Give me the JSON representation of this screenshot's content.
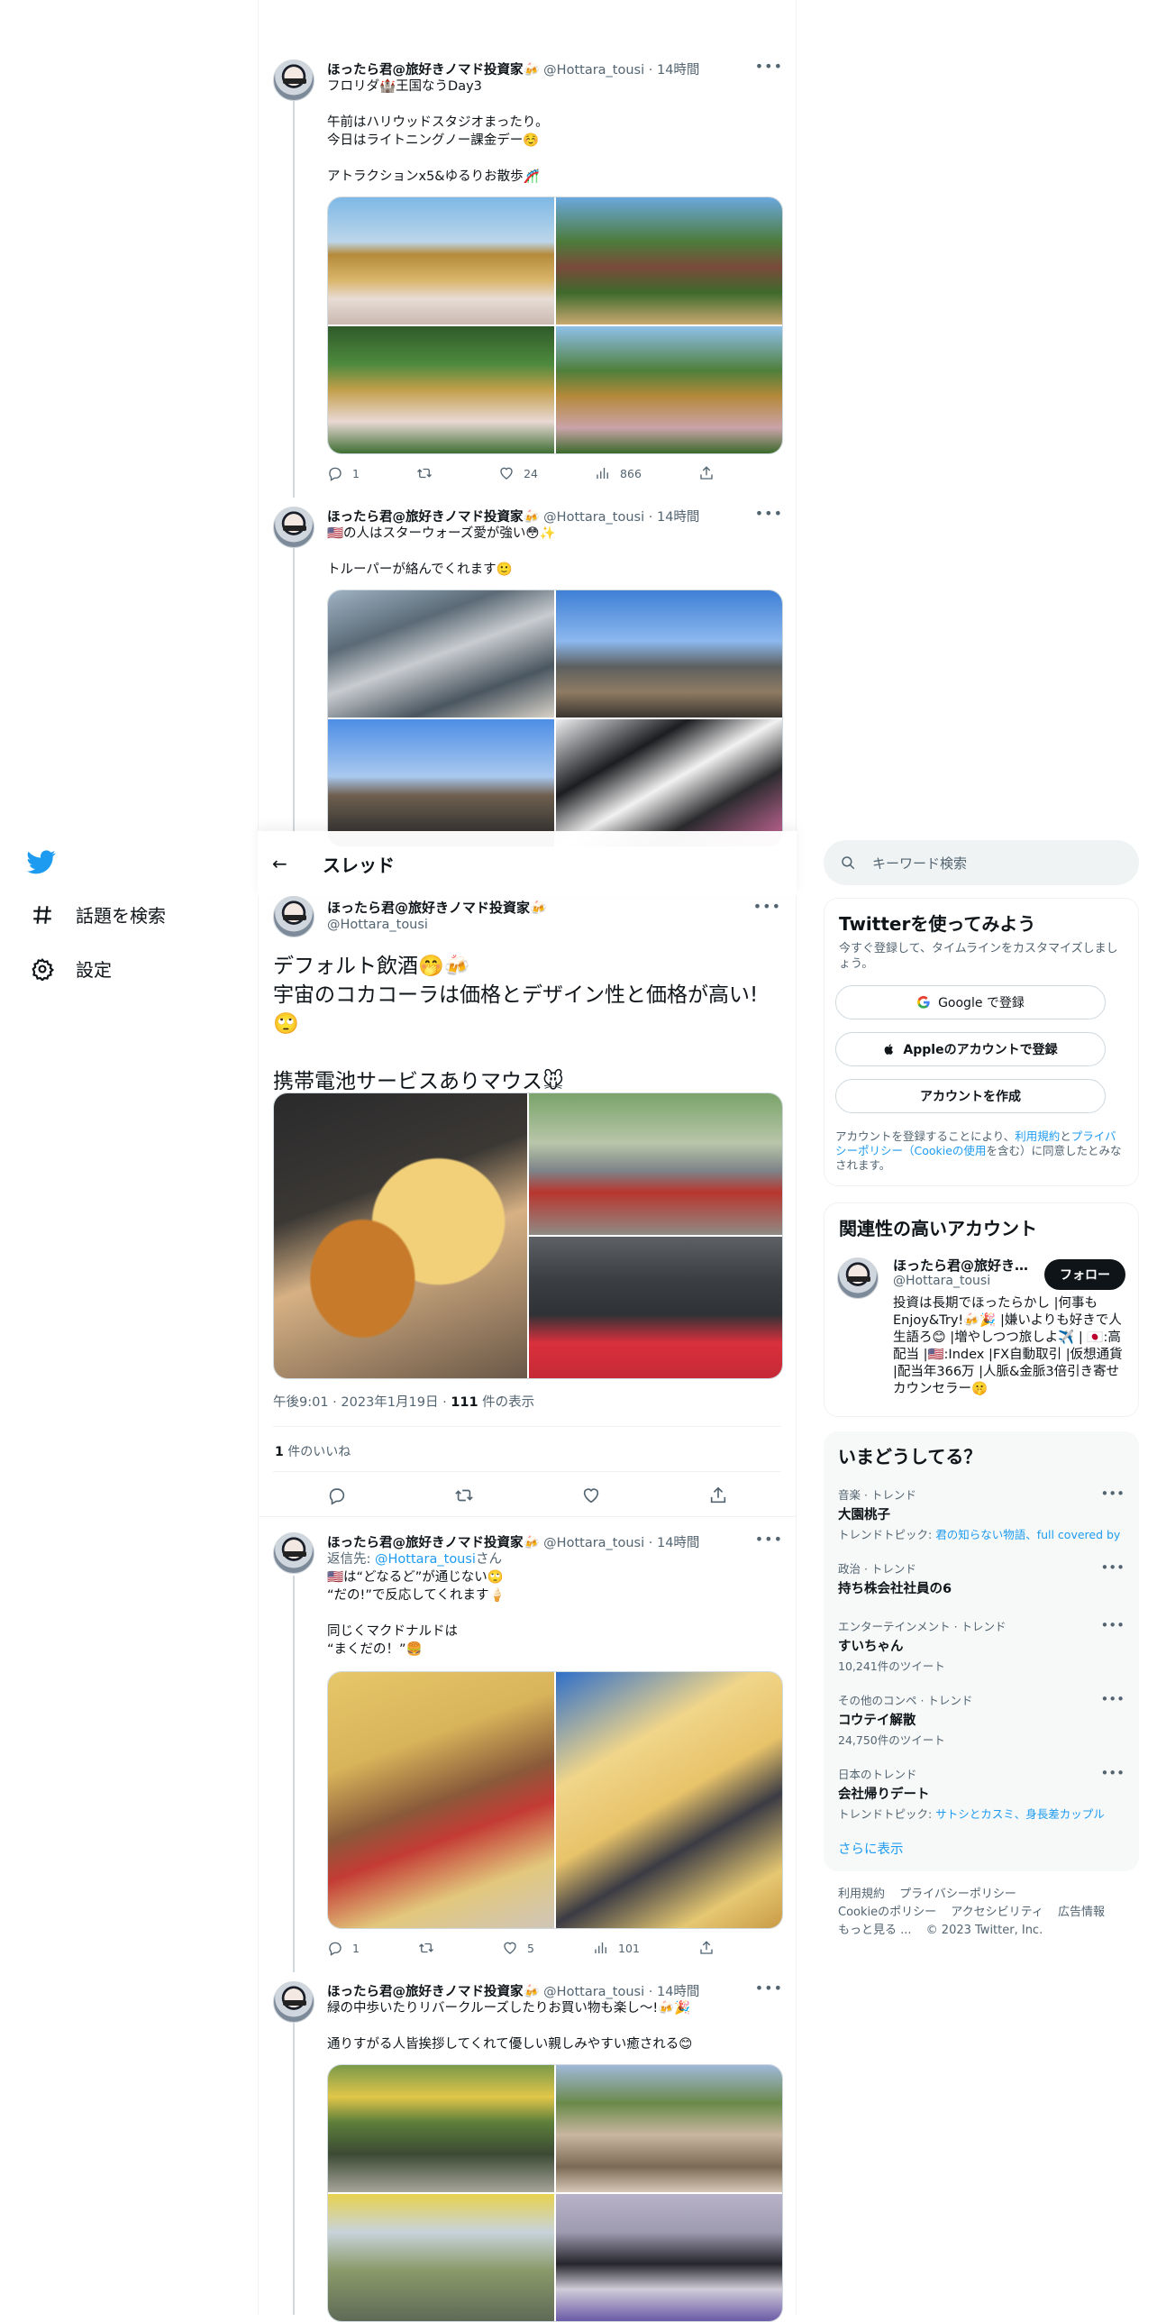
{
  "nav": {
    "items": [
      {
        "label": "話題を検索",
        "icon": "hashtag-icon"
      },
      {
        "label": "設定",
        "icon": "gear-icon"
      }
    ]
  },
  "tweets_above": [
    {
      "name": "ほったら君@旅好きノマド投資家🍻",
      "handle": "@Hottara_tousi",
      "time": "14時間",
      "text": "フロリダ🏰王国なうDay3\n\n午前はハリウッドスタジオまったり。\n今日はライトニングノー課金デー☺️\n\nアトラクションx5&ゆるりお散歩🎢",
      "replies": "1",
      "retweets": "",
      "likes": "24",
      "views": "866"
    },
    {
      "name": "ほったら君@旅好きノマド投資家🍻",
      "handle": "@Hottara_tousi",
      "time": "14時間",
      "text": "🇺🇸の人はスターウォーズ愛が強い😳✨\n\nトルーパーが絡んでくれます🙂"
    }
  ],
  "thread_header": {
    "title": "スレッド"
  },
  "focus_tweet": {
    "name": "ほったら君@旅好きノマド投資家🍻",
    "handle": "@Hottara_tousi",
    "text": "デフォルト飲酒🤭🍻\n宇宙のコカコーラは価格とデザイン性と価格が高い!🙄\n\n携帯電池サービスありマウス🐭",
    "timestamp": "午後9:01 · 2023年1月19日 · ",
    "views_count": "111",
    "views_label": " 件の表示",
    "likes_count": "1",
    "likes_label": " 件のいいね"
  },
  "reply_tweets": [
    {
      "name": "ほったら君@旅好きノマド投資家🍻",
      "handle": "@Hottara_tousi",
      "time": "14時間",
      "reply_prefix": "返信先: ",
      "reply_to": "@Hottara_tousi",
      "reply_suffix": "さん",
      "text": "🇺🇸は“どなるど”が通じない🙄\n“だの!”で反応してくれます🍦\n\n同じくマクドナルドは\n“まくだの！”🍔",
      "replies": "1",
      "retweets": "",
      "likes": "5",
      "views": "101"
    },
    {
      "name": "ほったら君@旅好きノマド投資家🍻",
      "handle": "@Hottara_tousi",
      "time": "14時間",
      "text": "緑の中歩いたりリバークルーズしたりお買い物も楽し〜!🍻🎉\n\n通りすがる人皆挨拶してくれて優しい親しみやすい癒される😊"
    }
  ],
  "search": {
    "placeholder": "キーワード検索"
  },
  "signup": {
    "title": "Twitterを使ってみよう",
    "subtitle": "今すぐ登録して、タイムラインをカスタマイズしましょう。",
    "google_label": "Google で登録",
    "apple_label": "Appleのアカウントで登録",
    "create_label": "アカウントを作成",
    "legal_pre": "アカウントを登録することにより、",
    "legal_terms": "利用規約",
    "legal_and": "と",
    "legal_privacy": "プライバシーポリシー（Cookieの使用",
    "legal_post": "を含む）に同意したとみなされます。"
  },
  "relevant": {
    "title": "関連性の高いアカウント",
    "name": "ほったら君@旅好きノマド投資家🍻",
    "handle": "@Hottara_tousi",
    "follow_label": "フォロー",
    "bio": "投資は長期でほったらかし |何事もEnjoy&Try!🍻🎉 |嫌いよりも好きで人生語ろ😊 |増やしつつ旅しよ✈️ | 🇯🇵:高配当 |🇺🇸:Index |FX自動取引 |仮想通貨 |配当年366万 |人脈&金脈3倍引き寄せカウンセラー🤫"
  },
  "trends": {
    "title": "いまどうしてる？",
    "items": [
      {
        "context": "音楽 · トレンド",
        "name": "大園桃子",
        "sub_prefix": "トレンドトピック: ",
        "sub_link": "君の知らない物語、full covered by"
      },
      {
        "context": "政治 · トレンド",
        "name": "持ち株会社社員の6",
        "sub_prefix": "",
        "sub_link": ""
      },
      {
        "context": "エンターテインメント · トレンド",
        "name": "すいちゃん",
        "sub_prefix": "10,241件のツイート",
        "sub_link": ""
      },
      {
        "context": "その他のコンペ · トレンド",
        "name": "コウテイ解散",
        "sub_prefix": "24,750件のツイート",
        "sub_link": ""
      },
      {
        "context": "日本のトレンド",
        "name": "会社帰りデート",
        "sub_prefix": "トレンドトピック: ",
        "sub_link": "サトシとカスミ、身長差カップル"
      }
    ],
    "show_more": "さらに表示"
  },
  "footer": {
    "links": [
      "利用規約",
      "プライバシーポリシー",
      "Cookieのポリシー",
      "アクセシビリティ",
      "広告情報",
      "もっと見る ...",
      "© 2023 Twitter, Inc."
    ]
  },
  "colors": {
    "accent": "#1d9bf0",
    "text": "#0f1419",
    "muted": "#536471",
    "border": "#eff3f4"
  }
}
